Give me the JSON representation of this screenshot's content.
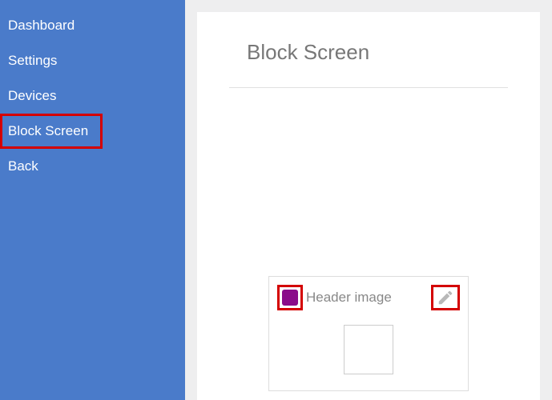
{
  "sidebar": {
    "items": [
      {
        "label": "Dashboard",
        "highlighted": false
      },
      {
        "label": "Settings",
        "highlighted": false
      },
      {
        "label": "Devices",
        "highlighted": false
      },
      {
        "label": "Block Screen",
        "highlighted": true
      },
      {
        "label": "Back",
        "highlighted": false
      }
    ]
  },
  "main": {
    "title": "Block Screen",
    "panel": {
      "label": "Header image",
      "swatch_color": "#8a0c8a"
    }
  }
}
